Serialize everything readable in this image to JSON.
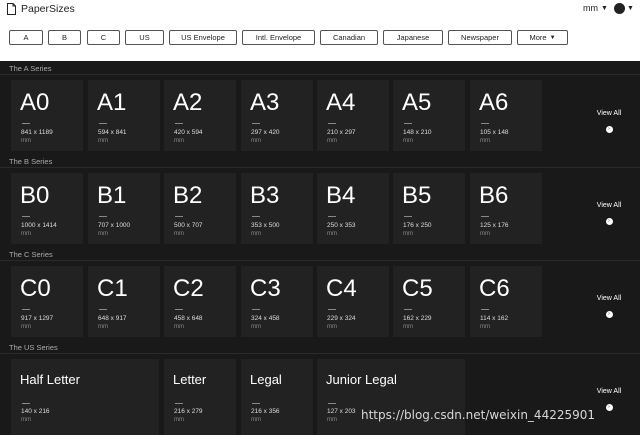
{
  "app": {
    "title": "PaperSizes",
    "units": "mm"
  },
  "filters": [
    "A",
    "B",
    "C",
    "US",
    "US Envelope",
    "Intl. Envelope",
    "Canadian",
    "Japanese",
    "Newspaper",
    "More"
  ],
  "view_all_label": "View All",
  "sections": [
    {
      "title": "The A Series",
      "cards": [
        {
          "name": "A0",
          "dims": "841 x 1189",
          "unit": "mm"
        },
        {
          "name": "A1",
          "dims": "594 x 841",
          "unit": "mm"
        },
        {
          "name": "A2",
          "dims": "420 x 594",
          "unit": "mm"
        },
        {
          "name": "A3",
          "dims": "297 x 420",
          "unit": "mm"
        },
        {
          "name": "A4",
          "dims": "210 x 297",
          "unit": "mm"
        },
        {
          "name": "A5",
          "dims": "148 x 210",
          "unit": "mm"
        },
        {
          "name": "A6",
          "dims": "105 x 148",
          "unit": "mm"
        }
      ]
    },
    {
      "title": "The B Series",
      "cards": [
        {
          "name": "B0",
          "dims": "1000 x 1414",
          "unit": "mm"
        },
        {
          "name": "B1",
          "dims": "707 x 1000",
          "unit": "mm"
        },
        {
          "name": "B2",
          "dims": "500 x 707",
          "unit": "mm"
        },
        {
          "name": "B3",
          "dims": "353 x 500",
          "unit": "mm"
        },
        {
          "name": "B4",
          "dims": "250 x 353",
          "unit": "mm"
        },
        {
          "name": "B5",
          "dims": "176 x 250",
          "unit": "mm"
        },
        {
          "name": "B6",
          "dims": "125 x 176",
          "unit": "mm"
        }
      ]
    },
    {
      "title": "The C Series",
      "cards": [
        {
          "name": "C0",
          "dims": "917 x 1297",
          "unit": "mm"
        },
        {
          "name": "C1",
          "dims": "648 x 917",
          "unit": "mm"
        },
        {
          "name": "C2",
          "dims": "458 x 648",
          "unit": "mm"
        },
        {
          "name": "C3",
          "dims": "324 x 458",
          "unit": "mm"
        },
        {
          "name": "C4",
          "dims": "229 x 324",
          "unit": "mm"
        },
        {
          "name": "C5",
          "dims": "162 x 229",
          "unit": "mm"
        },
        {
          "name": "C6",
          "dims": "114 x 162",
          "unit": "mm"
        }
      ]
    },
    {
      "title": "The US Series",
      "cards": [
        {
          "name": "Half Letter",
          "dims": "140 x 216",
          "unit": "mm"
        },
        {
          "name": "Letter",
          "dims": "216 x 279",
          "unit": "mm"
        },
        {
          "name": "Legal",
          "dims": "216 x 356",
          "unit": "mm"
        },
        {
          "name": "Junior Legal",
          "dims": "127 x 203",
          "unit": "mm"
        }
      ]
    }
  ],
  "watermark": "https://blog.csdn.net/weixin_44225901"
}
